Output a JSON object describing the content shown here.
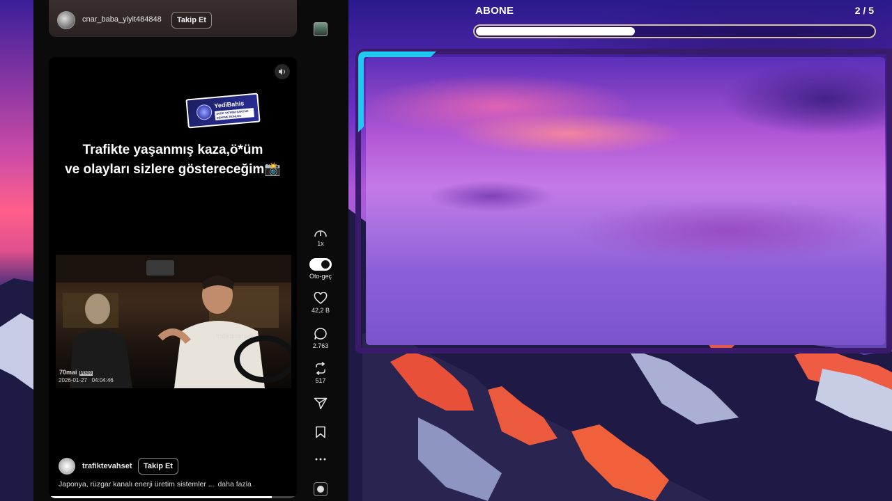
{
  "overlay": {
    "goal_title": "ABONE",
    "goal_count": "2 / 5",
    "goal_progress": 0.4
  },
  "feed": {
    "previous_post": {
      "username": "cnar_baba_yiyit484848",
      "follow_label": "Takip Et"
    },
    "current_post": {
      "caption_line1": "Trafikte yaşanmış kaza,ö*üm",
      "caption_line2": "ve olayları sizlere göstereceğim📸",
      "sponsor_brand": "YediBahis",
      "sponsor_tag": "SODE YATIRIM ŞARTSIZ DENEME BONUSU",
      "clip_watermark": "trafiktevahset",
      "clip_camera_brand": "70mai",
      "clip_camera_model": "M300",
      "clip_date": "2026-01-27",
      "clip_time": "04:04:46",
      "username": "trafiktevahset",
      "follow_label": "Takip Et",
      "description": "Japonya, rüzgar kanalı enerji üretim sistemler ...",
      "more_label": "daha fazla",
      "playback_progress": 0.9
    }
  },
  "actions": {
    "speed_label": "1x",
    "autoplay_label": "Oto-geç",
    "autoplay_on": true,
    "likes": "42,2 B",
    "comments": "2.763",
    "reposts": "517"
  },
  "icons": {
    "more": "more-icon",
    "speed": "speedometer-icon",
    "like": "heart-icon",
    "comment": "comment-icon",
    "repost": "repost-icon",
    "share": "send-icon",
    "bookmark": "bookmark-icon",
    "volume": "speaker-icon"
  },
  "colors": {
    "panel_bg": "#0b0b0b",
    "frame_cyan": "#21c8f0",
    "frame_purple": "#3a1a6a",
    "goal_border": "#d8c6a0"
  }
}
